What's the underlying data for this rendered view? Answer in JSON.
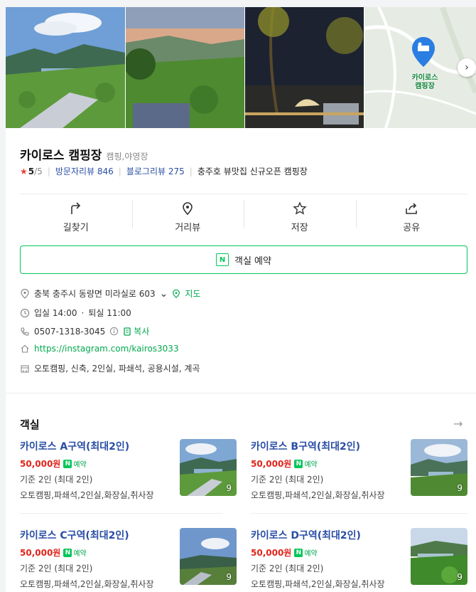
{
  "place": {
    "name": "카이로스 캠핑장",
    "category": "캠핑,야영장",
    "rating_star": "★",
    "rating": "5",
    "rating_max": "/5",
    "visitor_review_label": "방문자리뷰",
    "visitor_review_count": "846",
    "blog_review_label": "블로그리뷰",
    "blog_review_count": "275",
    "tagline": "충주호 뷰맛집 신규오픈 캠핑장"
  },
  "map": {
    "pin_label_line1": "카이로스",
    "pin_label_line2": "캠핑장",
    "chevron": "›"
  },
  "actions": [
    {
      "label": "길찾기",
      "icon": "directions-icon"
    },
    {
      "label": "거리뷰",
      "icon": "street-view-icon"
    },
    {
      "label": "저장",
      "icon": "star-icon"
    },
    {
      "label": "공유",
      "icon": "share-icon"
    }
  ],
  "reserve": {
    "label": "객실 예약",
    "badge": "N"
  },
  "info": {
    "address": "충북 충주시 동량면 미라실로 603",
    "map_link": "지도",
    "hours_in": "입실 14:00",
    "hours_sep": "·",
    "hours_out": "퇴실 11:00",
    "phone": "0507-1318-3045",
    "copy_label": "복사",
    "website": "https://instagram.com/kairos3033",
    "amenities": "오토캠핑, 신축, 2인실, 파쇄석, 공용시설, 계곡"
  },
  "rooms_section": {
    "title": "객실",
    "arrow": "→"
  },
  "rooms": [
    {
      "name": "카이로스 A구역(최대2인)",
      "price": "50,000원",
      "tag": "예약",
      "capacity": "기준 2인 (최대 2인)",
      "desc": "오토캠핑,파쇄석,2인실,화장실,취사장",
      "photo_count": "9"
    },
    {
      "name": "카이로스 B구역(최대2인)",
      "price": "50,000원",
      "tag": "예약",
      "capacity": "기준 2인 (최대 2인)",
      "desc": "오토캠핑,파쇄석,2인실,화장실,취사장",
      "photo_count": "9"
    },
    {
      "name": "카이로스 C구역(최대2인)",
      "price": "50,000원",
      "tag": "예약",
      "capacity": "기준 2인 (최대 2인)",
      "desc": "오토캠핑,파쇄석,2인실,화장실,취사장",
      "photo_count": "9"
    },
    {
      "name": "카이로스 D구역(최대2인)",
      "price": "50,000원",
      "tag": "예약",
      "capacity": "기준 2인 (최대 2인)",
      "desc": "오토캠핑,파쇄석,2인실,화장실,취사장",
      "photo_count": "9"
    }
  ],
  "colors": {
    "accent_green": "#03c75a",
    "link_blue": "#2a4ea5",
    "price_red": "#e2231a",
    "star_red": "#ef3f33"
  }
}
